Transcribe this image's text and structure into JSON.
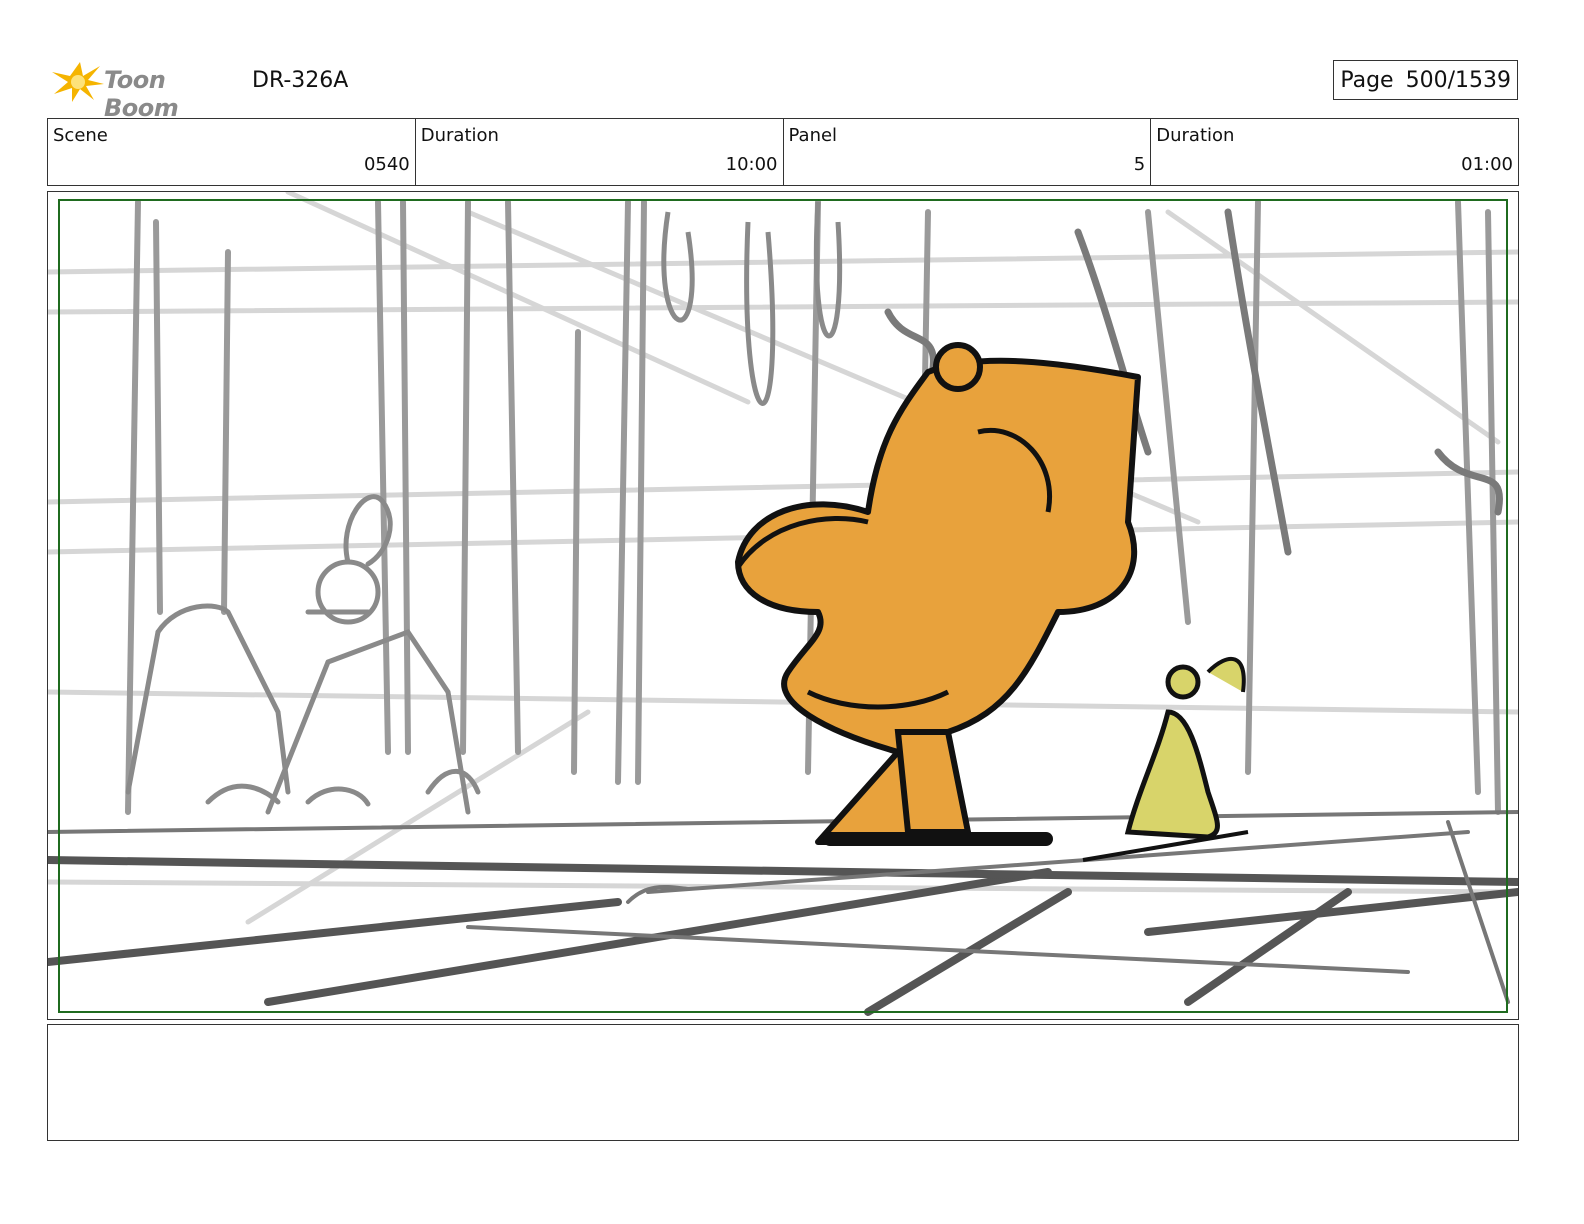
{
  "header": {
    "logo_text": "Toon Boom",
    "doc_id": "DR-326A",
    "page_label": "Page",
    "page_value": "500/1539"
  },
  "info": {
    "scene_label": "Scene",
    "scene_value": "0540",
    "scene_duration_label": "Duration",
    "scene_duration_value": "10:00",
    "panel_label": "Panel",
    "panel_value": "5",
    "panel_duration_label": "Duration",
    "panel_duration_value": "01:00"
  },
  "panel": {
    "safe_frame_color": "#1f6b1f",
    "character_main_color": "#e8a23c",
    "character_small_color": "#d8d46a"
  },
  "notes": {
    "text": ""
  },
  "colors": {
    "logo_star": "#f5b400",
    "border": "#333333"
  }
}
